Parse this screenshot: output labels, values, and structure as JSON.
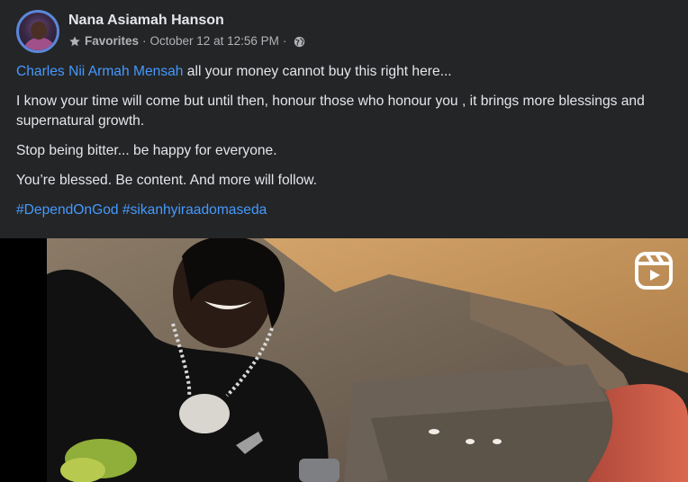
{
  "post": {
    "author": "Nana Asiamah Hanson",
    "audience_label": "Favorites",
    "separator": "·",
    "timestamp": "October 12 at 12:56 PM",
    "privacy_icon": "globe-icon",
    "favorite_icon": "star-icon",
    "mention": "Charles Nii Armah Mensah",
    "line1_rest": " all your money cannot buy this right here...",
    "line2": "I know your time will come but until then, honour those who honour you , it brings more blessings and supernatural growth.",
    "line3": "Stop being bitter... be happy for everyone.",
    "line4": "You’re blessed. Be content. And more will follow.",
    "hashtag1": "#DependOnGod",
    "hashtag2": "#sikanhyiraadomaseda"
  },
  "media": {
    "type": "reel-video",
    "reels_icon": "reels-icon"
  },
  "colors": {
    "background": "#242526",
    "text": "#e4e6eb",
    "secondary_text": "#b0b3b8",
    "link": "#4599ff",
    "avatar_ring": "#5b87d9"
  }
}
